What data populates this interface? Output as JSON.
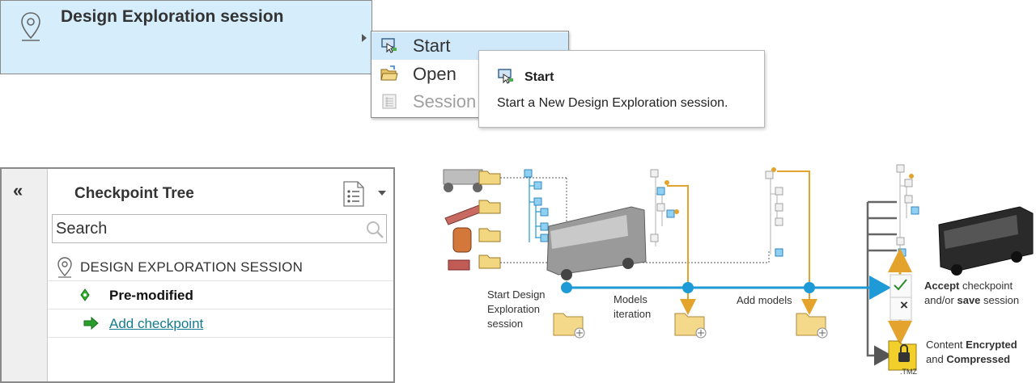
{
  "session_header": {
    "title": "Design Exploration session"
  },
  "dropdown": {
    "items": [
      {
        "label": "Start",
        "icon": "start-session-icon",
        "highlighted": true
      },
      {
        "label": "Open",
        "icon": "open-folder-icon"
      },
      {
        "label": "Session",
        "icon": "session-list-icon",
        "disabled": true
      }
    ]
  },
  "tooltip": {
    "title": "Start",
    "description": "Start a New Design Exploration session."
  },
  "checkpoint_tree": {
    "collapse": "«",
    "title": "Checkpoint Tree",
    "search_placeholder": "Search",
    "root": "DESIGN EXPLORATION SESSION",
    "pre_modified": "Pre-modified",
    "add_checkpoint": "Add checkpoint"
  },
  "diagram": {
    "start_label": [
      "Start Design",
      "Exploration",
      "session"
    ],
    "models_label": [
      "Models",
      "iteration"
    ],
    "add_models_label": "Add models",
    "accept_bold": "Accept",
    "accept_rest": " checkpoint",
    "accept_line2_pre": "and/or ",
    "accept_line2_bold": "save",
    "accept_line2_post": " session",
    "content_line1_pre": "Content ",
    "content_line1_bold": "Encrypted",
    "content_line2_pre": "and ",
    "content_line2_bold": "Compressed",
    "tmz_label": ".TMZ",
    "reject_symbol": "×"
  },
  "colors": {
    "blue": "#1e9ad6",
    "orange": "#e3a32c",
    "highlight": "#cfe9fb",
    "link": "#157a8f"
  }
}
